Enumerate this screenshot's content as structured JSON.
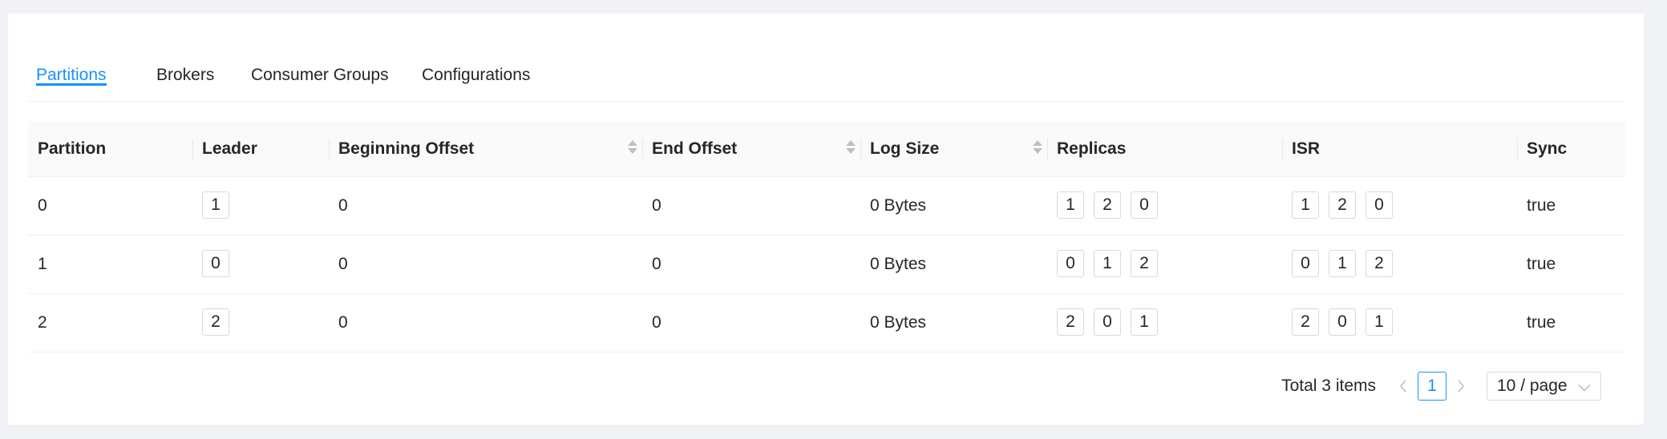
{
  "tabs": [
    {
      "label": "Partitions",
      "active": true
    },
    {
      "label": "Brokers",
      "active": false
    },
    {
      "label": "Consumer Groups",
      "active": false
    },
    {
      "label": "Configurations",
      "active": false
    }
  ],
  "table": {
    "columns": [
      "Partition",
      "Leader",
      "Beginning Offset",
      "End Offset",
      "Log Size",
      "Replicas",
      "ISR",
      "Sync"
    ],
    "sortable": [
      "Beginning Offset",
      "End Offset",
      "Log Size"
    ],
    "rows": [
      {
        "partition": "0",
        "leader": "1",
        "beginning_offset": "0",
        "end_offset": "0",
        "log_size": "0 Bytes",
        "replicas": [
          "1",
          "2",
          "0"
        ],
        "isr": [
          "1",
          "2",
          "0"
        ],
        "sync": "true"
      },
      {
        "partition": "1",
        "leader": "0",
        "beginning_offset": "0",
        "end_offset": "0",
        "log_size": "0 Bytes",
        "replicas": [
          "0",
          "1",
          "2"
        ],
        "isr": [
          "0",
          "1",
          "2"
        ],
        "sync": "true"
      },
      {
        "partition": "2",
        "leader": "2",
        "beginning_offset": "0",
        "end_offset": "0",
        "log_size": "0 Bytes",
        "replicas": [
          "2",
          "0",
          "1"
        ],
        "isr": [
          "2",
          "0",
          "1"
        ],
        "sync": "true"
      }
    ]
  },
  "pagination": {
    "total_text": "Total 3 items",
    "current_page": "1",
    "page_size": "10 / page",
    "prev_icon": "chevron-left-icon",
    "next_icon": "chevron-right-icon",
    "select_icon": "chevron-down-icon"
  },
  "colors": {
    "accent": "#1890ff",
    "page_background": "#f0f2f5",
    "card_background": "#ffffff",
    "header_background": "#fafafa",
    "border": "#d9d9d9"
  }
}
